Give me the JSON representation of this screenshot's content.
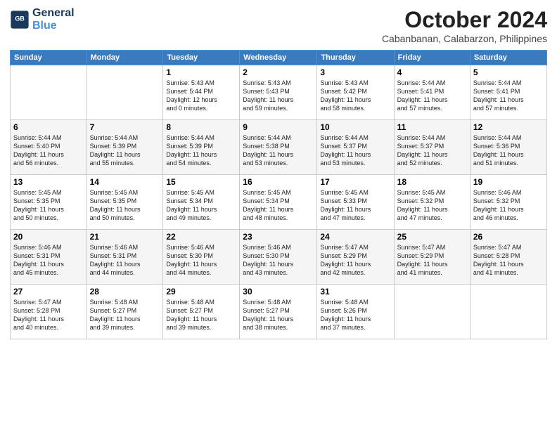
{
  "header": {
    "logo_line1": "General",
    "logo_line2": "Blue",
    "month": "October 2024",
    "location": "Cabanbanan, Calabarzon, Philippines"
  },
  "columns": [
    "Sunday",
    "Monday",
    "Tuesday",
    "Wednesday",
    "Thursday",
    "Friday",
    "Saturday"
  ],
  "weeks": [
    [
      {
        "day": "",
        "info": ""
      },
      {
        "day": "",
        "info": ""
      },
      {
        "day": "1",
        "info": "Sunrise: 5:43 AM\nSunset: 5:44 PM\nDaylight: 12 hours\nand 0 minutes."
      },
      {
        "day": "2",
        "info": "Sunrise: 5:43 AM\nSunset: 5:43 PM\nDaylight: 11 hours\nand 59 minutes."
      },
      {
        "day": "3",
        "info": "Sunrise: 5:43 AM\nSunset: 5:42 PM\nDaylight: 11 hours\nand 58 minutes."
      },
      {
        "day": "4",
        "info": "Sunrise: 5:44 AM\nSunset: 5:41 PM\nDaylight: 11 hours\nand 57 minutes."
      },
      {
        "day": "5",
        "info": "Sunrise: 5:44 AM\nSunset: 5:41 PM\nDaylight: 11 hours\nand 57 minutes."
      }
    ],
    [
      {
        "day": "6",
        "info": "Sunrise: 5:44 AM\nSunset: 5:40 PM\nDaylight: 11 hours\nand 56 minutes."
      },
      {
        "day": "7",
        "info": "Sunrise: 5:44 AM\nSunset: 5:39 PM\nDaylight: 11 hours\nand 55 minutes."
      },
      {
        "day": "8",
        "info": "Sunrise: 5:44 AM\nSunset: 5:39 PM\nDaylight: 11 hours\nand 54 minutes."
      },
      {
        "day": "9",
        "info": "Sunrise: 5:44 AM\nSunset: 5:38 PM\nDaylight: 11 hours\nand 53 minutes."
      },
      {
        "day": "10",
        "info": "Sunrise: 5:44 AM\nSunset: 5:37 PM\nDaylight: 11 hours\nand 53 minutes."
      },
      {
        "day": "11",
        "info": "Sunrise: 5:44 AM\nSunset: 5:37 PM\nDaylight: 11 hours\nand 52 minutes."
      },
      {
        "day": "12",
        "info": "Sunrise: 5:44 AM\nSunset: 5:36 PM\nDaylight: 11 hours\nand 51 minutes."
      }
    ],
    [
      {
        "day": "13",
        "info": "Sunrise: 5:45 AM\nSunset: 5:35 PM\nDaylight: 11 hours\nand 50 minutes."
      },
      {
        "day": "14",
        "info": "Sunrise: 5:45 AM\nSunset: 5:35 PM\nDaylight: 11 hours\nand 50 minutes."
      },
      {
        "day": "15",
        "info": "Sunrise: 5:45 AM\nSunset: 5:34 PM\nDaylight: 11 hours\nand 49 minutes."
      },
      {
        "day": "16",
        "info": "Sunrise: 5:45 AM\nSunset: 5:34 PM\nDaylight: 11 hours\nand 48 minutes."
      },
      {
        "day": "17",
        "info": "Sunrise: 5:45 AM\nSunset: 5:33 PM\nDaylight: 11 hours\nand 47 minutes."
      },
      {
        "day": "18",
        "info": "Sunrise: 5:45 AM\nSunset: 5:32 PM\nDaylight: 11 hours\nand 47 minutes."
      },
      {
        "day": "19",
        "info": "Sunrise: 5:46 AM\nSunset: 5:32 PM\nDaylight: 11 hours\nand 46 minutes."
      }
    ],
    [
      {
        "day": "20",
        "info": "Sunrise: 5:46 AM\nSunset: 5:31 PM\nDaylight: 11 hours\nand 45 minutes."
      },
      {
        "day": "21",
        "info": "Sunrise: 5:46 AM\nSunset: 5:31 PM\nDaylight: 11 hours\nand 44 minutes."
      },
      {
        "day": "22",
        "info": "Sunrise: 5:46 AM\nSunset: 5:30 PM\nDaylight: 11 hours\nand 44 minutes."
      },
      {
        "day": "23",
        "info": "Sunrise: 5:46 AM\nSunset: 5:30 PM\nDaylight: 11 hours\nand 43 minutes."
      },
      {
        "day": "24",
        "info": "Sunrise: 5:47 AM\nSunset: 5:29 PM\nDaylight: 11 hours\nand 42 minutes."
      },
      {
        "day": "25",
        "info": "Sunrise: 5:47 AM\nSunset: 5:29 PM\nDaylight: 11 hours\nand 41 minutes."
      },
      {
        "day": "26",
        "info": "Sunrise: 5:47 AM\nSunset: 5:28 PM\nDaylight: 11 hours\nand 41 minutes."
      }
    ],
    [
      {
        "day": "27",
        "info": "Sunrise: 5:47 AM\nSunset: 5:28 PM\nDaylight: 11 hours\nand 40 minutes."
      },
      {
        "day": "28",
        "info": "Sunrise: 5:48 AM\nSunset: 5:27 PM\nDaylight: 11 hours\nand 39 minutes."
      },
      {
        "day": "29",
        "info": "Sunrise: 5:48 AM\nSunset: 5:27 PM\nDaylight: 11 hours\nand 39 minutes."
      },
      {
        "day": "30",
        "info": "Sunrise: 5:48 AM\nSunset: 5:27 PM\nDaylight: 11 hours\nand 38 minutes."
      },
      {
        "day": "31",
        "info": "Sunrise: 5:48 AM\nSunset: 5:26 PM\nDaylight: 11 hours\nand 37 minutes."
      },
      {
        "day": "",
        "info": ""
      },
      {
        "day": "",
        "info": ""
      }
    ]
  ]
}
